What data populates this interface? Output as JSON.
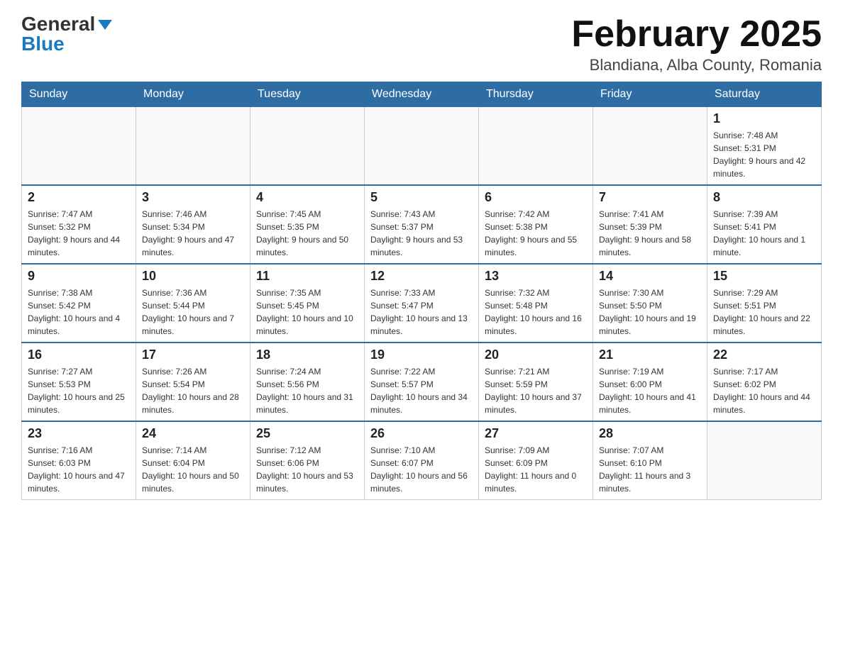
{
  "header": {
    "logo_general": "General",
    "logo_blue": "Blue",
    "month_title": "February 2025",
    "location": "Blandiana, Alba County, Romania"
  },
  "days_of_week": [
    "Sunday",
    "Monday",
    "Tuesday",
    "Wednesday",
    "Thursday",
    "Friday",
    "Saturday"
  ],
  "weeks": [
    [
      {
        "day": "",
        "info": ""
      },
      {
        "day": "",
        "info": ""
      },
      {
        "day": "",
        "info": ""
      },
      {
        "day": "",
        "info": ""
      },
      {
        "day": "",
        "info": ""
      },
      {
        "day": "",
        "info": ""
      },
      {
        "day": "1",
        "info": "Sunrise: 7:48 AM\nSunset: 5:31 PM\nDaylight: 9 hours and 42 minutes."
      }
    ],
    [
      {
        "day": "2",
        "info": "Sunrise: 7:47 AM\nSunset: 5:32 PM\nDaylight: 9 hours and 44 minutes."
      },
      {
        "day": "3",
        "info": "Sunrise: 7:46 AM\nSunset: 5:34 PM\nDaylight: 9 hours and 47 minutes."
      },
      {
        "day": "4",
        "info": "Sunrise: 7:45 AM\nSunset: 5:35 PM\nDaylight: 9 hours and 50 minutes."
      },
      {
        "day": "5",
        "info": "Sunrise: 7:43 AM\nSunset: 5:37 PM\nDaylight: 9 hours and 53 minutes."
      },
      {
        "day": "6",
        "info": "Sunrise: 7:42 AM\nSunset: 5:38 PM\nDaylight: 9 hours and 55 minutes."
      },
      {
        "day": "7",
        "info": "Sunrise: 7:41 AM\nSunset: 5:39 PM\nDaylight: 9 hours and 58 minutes."
      },
      {
        "day": "8",
        "info": "Sunrise: 7:39 AM\nSunset: 5:41 PM\nDaylight: 10 hours and 1 minute."
      }
    ],
    [
      {
        "day": "9",
        "info": "Sunrise: 7:38 AM\nSunset: 5:42 PM\nDaylight: 10 hours and 4 minutes."
      },
      {
        "day": "10",
        "info": "Sunrise: 7:36 AM\nSunset: 5:44 PM\nDaylight: 10 hours and 7 minutes."
      },
      {
        "day": "11",
        "info": "Sunrise: 7:35 AM\nSunset: 5:45 PM\nDaylight: 10 hours and 10 minutes."
      },
      {
        "day": "12",
        "info": "Sunrise: 7:33 AM\nSunset: 5:47 PM\nDaylight: 10 hours and 13 minutes."
      },
      {
        "day": "13",
        "info": "Sunrise: 7:32 AM\nSunset: 5:48 PM\nDaylight: 10 hours and 16 minutes."
      },
      {
        "day": "14",
        "info": "Sunrise: 7:30 AM\nSunset: 5:50 PM\nDaylight: 10 hours and 19 minutes."
      },
      {
        "day": "15",
        "info": "Sunrise: 7:29 AM\nSunset: 5:51 PM\nDaylight: 10 hours and 22 minutes."
      }
    ],
    [
      {
        "day": "16",
        "info": "Sunrise: 7:27 AM\nSunset: 5:53 PM\nDaylight: 10 hours and 25 minutes."
      },
      {
        "day": "17",
        "info": "Sunrise: 7:26 AM\nSunset: 5:54 PM\nDaylight: 10 hours and 28 minutes."
      },
      {
        "day": "18",
        "info": "Sunrise: 7:24 AM\nSunset: 5:56 PM\nDaylight: 10 hours and 31 minutes."
      },
      {
        "day": "19",
        "info": "Sunrise: 7:22 AM\nSunset: 5:57 PM\nDaylight: 10 hours and 34 minutes."
      },
      {
        "day": "20",
        "info": "Sunrise: 7:21 AM\nSunset: 5:59 PM\nDaylight: 10 hours and 37 minutes."
      },
      {
        "day": "21",
        "info": "Sunrise: 7:19 AM\nSunset: 6:00 PM\nDaylight: 10 hours and 41 minutes."
      },
      {
        "day": "22",
        "info": "Sunrise: 7:17 AM\nSunset: 6:02 PM\nDaylight: 10 hours and 44 minutes."
      }
    ],
    [
      {
        "day": "23",
        "info": "Sunrise: 7:16 AM\nSunset: 6:03 PM\nDaylight: 10 hours and 47 minutes."
      },
      {
        "day": "24",
        "info": "Sunrise: 7:14 AM\nSunset: 6:04 PM\nDaylight: 10 hours and 50 minutes."
      },
      {
        "day": "25",
        "info": "Sunrise: 7:12 AM\nSunset: 6:06 PM\nDaylight: 10 hours and 53 minutes."
      },
      {
        "day": "26",
        "info": "Sunrise: 7:10 AM\nSunset: 6:07 PM\nDaylight: 10 hours and 56 minutes."
      },
      {
        "day": "27",
        "info": "Sunrise: 7:09 AM\nSunset: 6:09 PM\nDaylight: 11 hours and 0 minutes."
      },
      {
        "day": "28",
        "info": "Sunrise: 7:07 AM\nSunset: 6:10 PM\nDaylight: 11 hours and 3 minutes."
      },
      {
        "day": "",
        "info": ""
      }
    ]
  ]
}
